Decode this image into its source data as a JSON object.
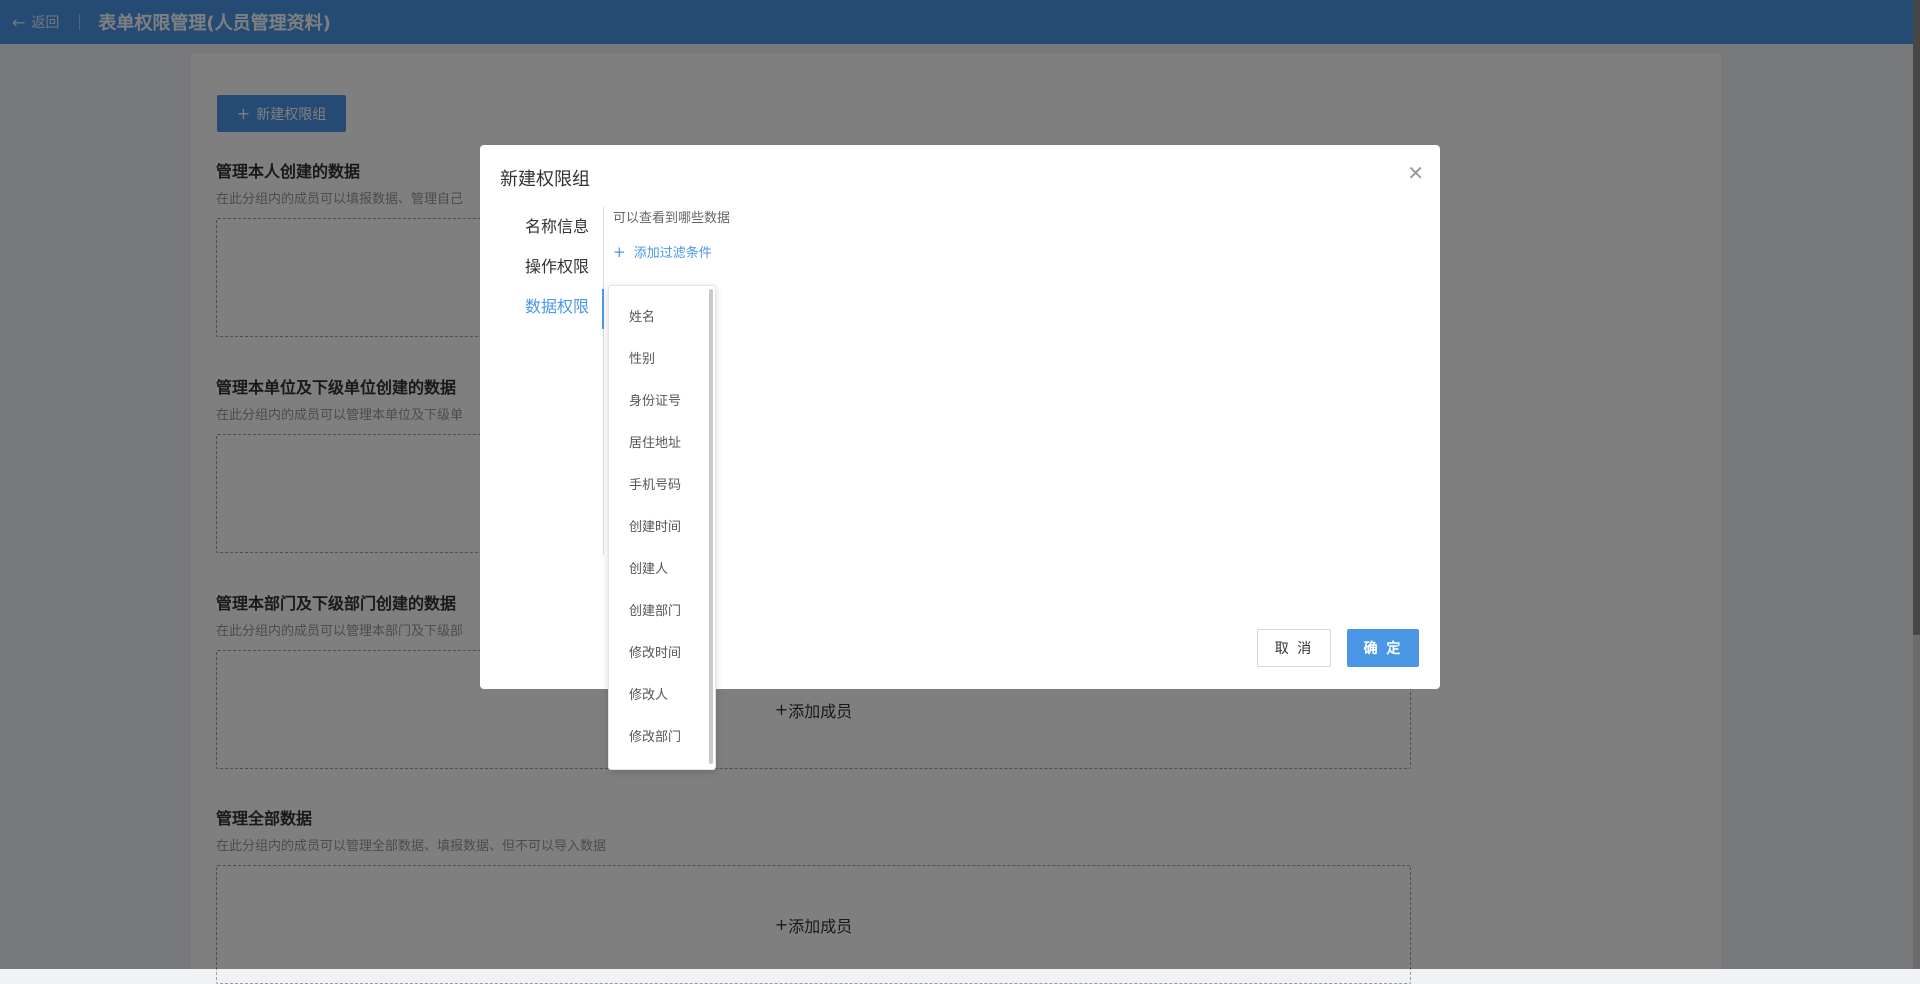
{
  "header": {
    "back_label": "返回",
    "title": "表单权限管理(人员管理资料)"
  },
  "toolbar": {
    "new_group_label": "新建权限组"
  },
  "sections": [
    {
      "title": "管理本人创建的数据",
      "desc": "在此分组内的成员可以填报数据、管理自己"
    },
    {
      "title": "管理本单位及下级单位创建的数据",
      "desc": "在此分组内的成员可以管理本单位及下级单"
    },
    {
      "title": "管理本部门及下级部门创建的数据",
      "desc": "在此分组内的成员可以管理本部门及下级部",
      "add_label": "添加成员"
    },
    {
      "title": "管理全部数据",
      "desc": "在此分组内的成员可以管理全部数据、填报数据、但不可以导入数据",
      "add_label": "添加成员"
    }
  ],
  "modal": {
    "title": "新建权限组",
    "tabs": [
      "名称信息",
      "操作权限",
      "数据权限"
    ],
    "active_tab": "数据权限",
    "data_label": "可以查看到哪些数据",
    "add_filter_label": "添加过滤条件",
    "cancel_label": "取 消",
    "confirm_label": "确 定"
  },
  "dropdown": {
    "options": [
      "姓名",
      "性别",
      "身份证号",
      "居住地址",
      "手机号码",
      "创建时间",
      "创建人",
      "创建部门",
      "修改时间",
      "修改人",
      "修改部门"
    ]
  },
  "icons": {
    "back": "arrow-left-icon",
    "close": "close-icon",
    "plus": "plus-icon"
  },
  "colors": {
    "primary": "#4a97e8",
    "overlay": "rgba(0,0,0,0.5)"
  }
}
